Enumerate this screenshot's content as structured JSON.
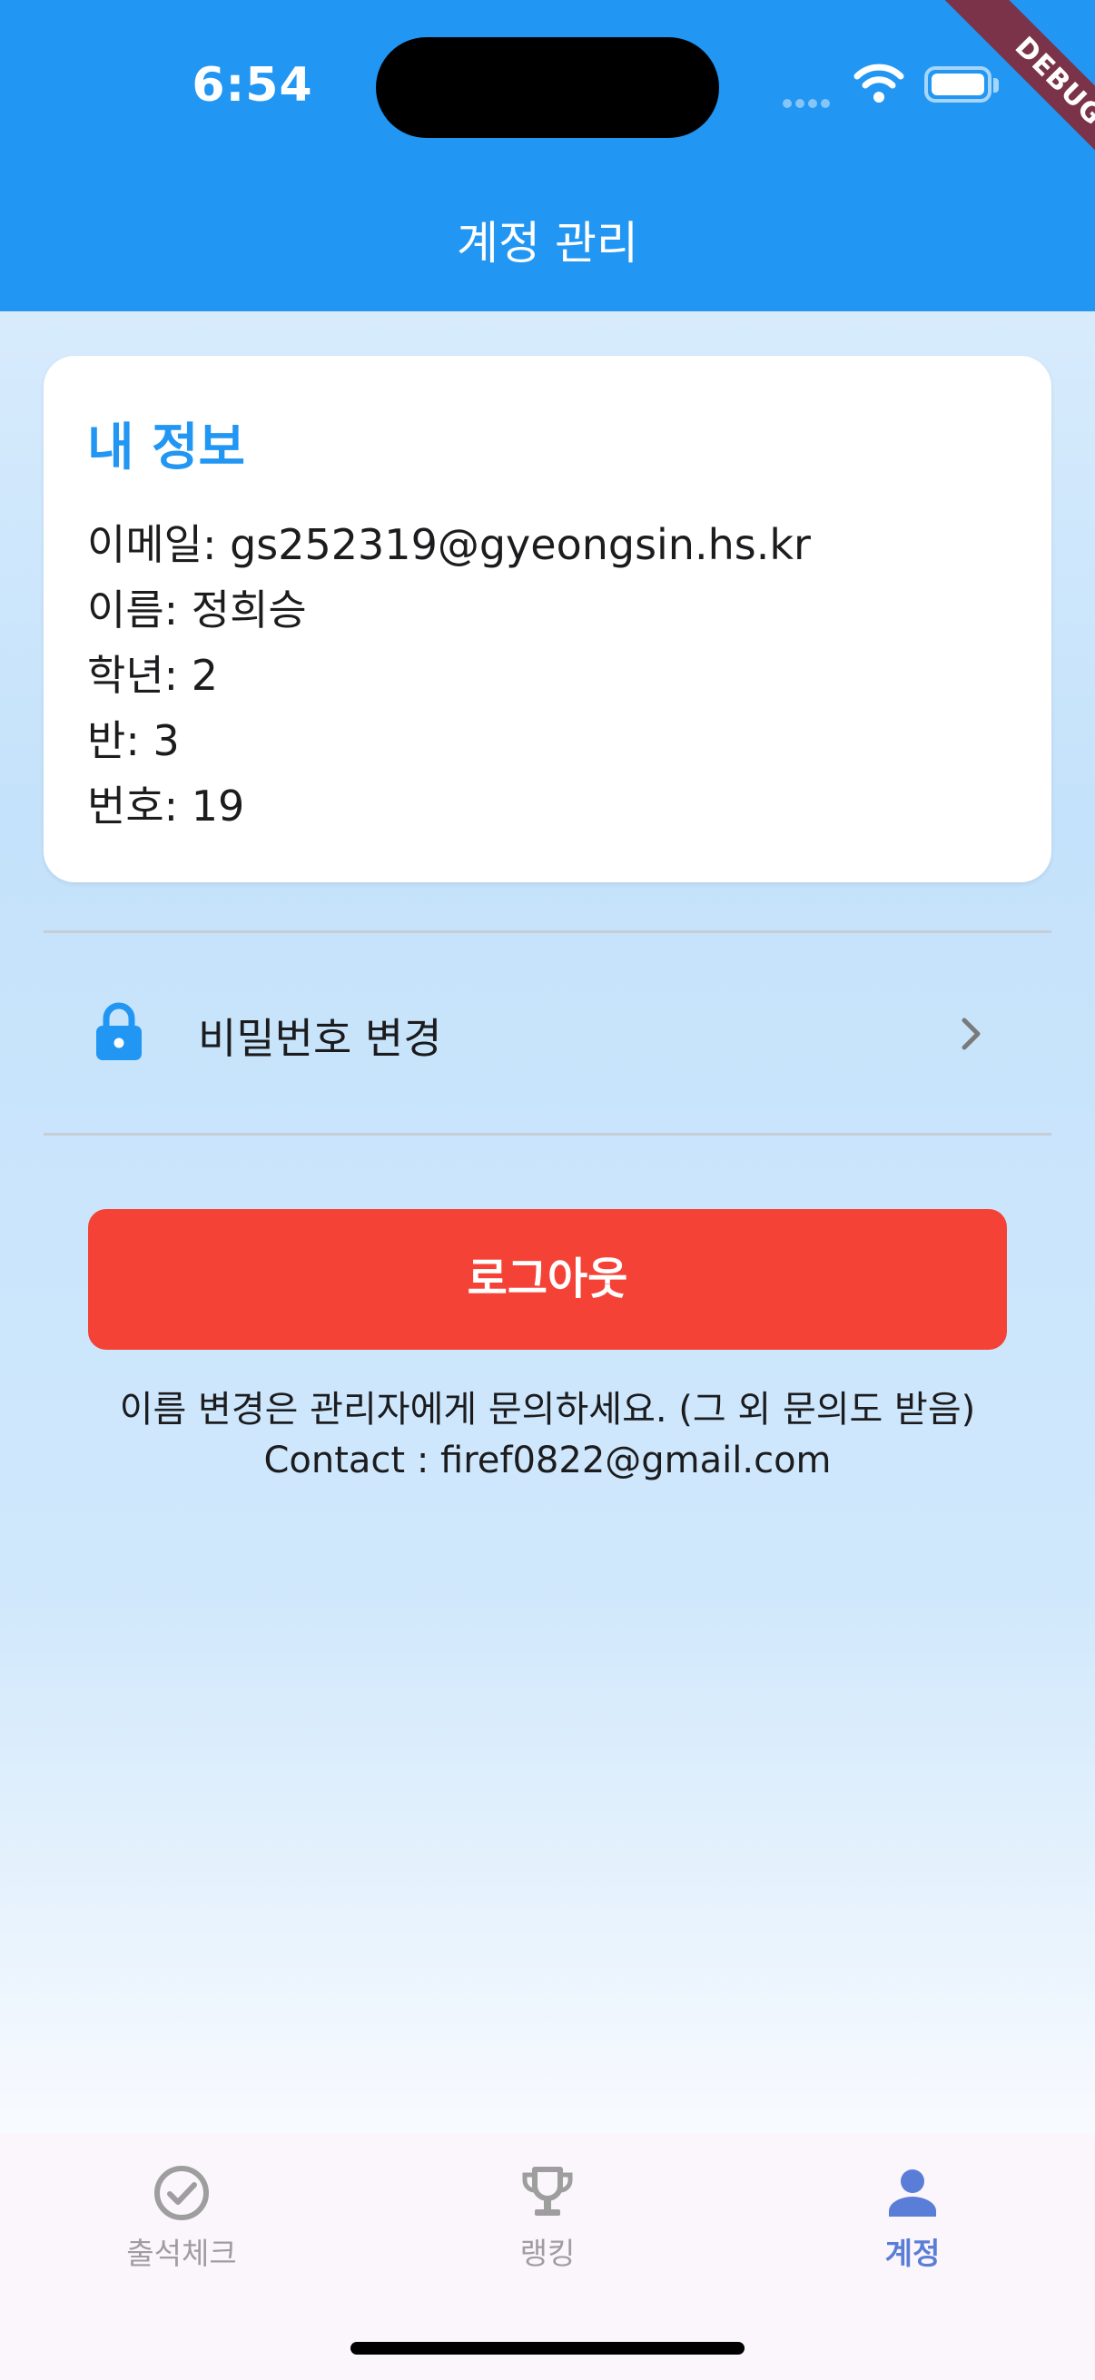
{
  "status_bar": {
    "time": "6:54"
  },
  "debug_banner": "DEBUG",
  "app_bar": {
    "title": "계정 관리"
  },
  "profile_card": {
    "title": "내 정보",
    "lines": [
      "이메일: gs252319@gyeongsin.hs.kr",
      "이름: 정희승",
      "학년: 2",
      "반: 3",
      "번호: 19"
    ]
  },
  "password_row": {
    "label": "비밀번호 변경",
    "icon": "lock-icon",
    "trailing_icon": "chevron-right-icon"
  },
  "logout_button": {
    "label": "로그아웃"
  },
  "notes": [
    "이름 변경은 관리자에게 문의하세요. (그 외 문의도 받음)",
    "Contact : firef0822@gmail.com"
  ],
  "bottom_nav": {
    "items": [
      {
        "label": "출석체크",
        "icon": "check-circle-icon",
        "active": false
      },
      {
        "label": "랭킹",
        "icon": "trophy-icon",
        "active": false
      },
      {
        "label": "계정",
        "icon": "person-icon",
        "active": true
      }
    ]
  },
  "colors": {
    "primary": "#2196f3",
    "logout": "#f44336",
    "nav_active": "#5a7ed8",
    "nav_inactive": "#9e9e9e"
  }
}
